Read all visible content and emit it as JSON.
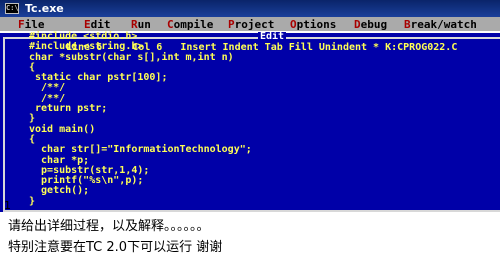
{
  "window": {
    "title": "Tc.exe",
    "icon": "console-window-icon"
  },
  "menu": [
    "File",
    "Edit",
    "Run",
    "Compile",
    "Project",
    "Options",
    "Debug",
    "Break/watch"
  ],
  "editor": {
    "panel_title": "Edit",
    "status_line": "Line 6     Col 6   Insert Indent Tab Fill Unindent * K:CPROG022.C",
    "code": [
      "#include <stdio.h>",
      "#include <string.h>",
      "char *substr(char s[],int m,int n)",
      "{",
      " static char pstr[100];",
      "  /**/",
      "  /**/",
      " return pstr;",
      "}",
      "void main()",
      "{",
      "  char str[]=\"InformationTechnology\";",
      "  char *p;",
      "  p=substr(str,1,4);",
      "  printf(\"%s\\n\",p);",
      "  getch();",
      "}"
    ]
  },
  "line_marker": "1",
  "question": {
    "line1": "请给出详细过程，以及解释。。。。。。",
    "line2": "特别注意要在TC 2.0下可以运行  谢谢"
  }
}
